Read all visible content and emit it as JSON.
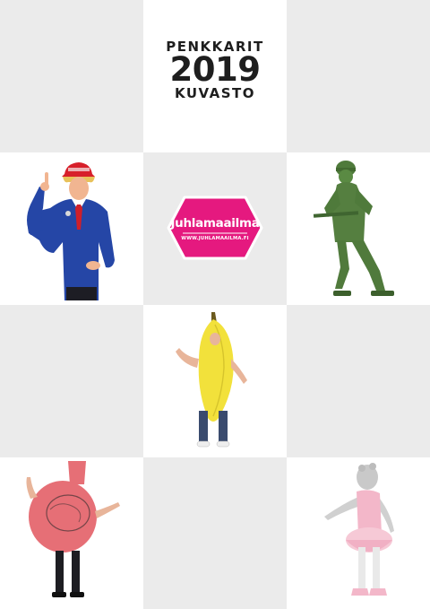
{
  "cover": {
    "title_top": "PENKKARIT",
    "title_year": "2019",
    "title_bottom": "KUVASTO"
  },
  "logo": {
    "brand": "Juhlamaailma",
    "url": "WWW.JUHLAMAAILMA.FI"
  },
  "colors": {
    "tile_gray": "#ebebeb",
    "brand_pink": "#e5197f",
    "title_text": "#1e1e1e"
  },
  "costumes": [
    {
      "name": "president-costume"
    },
    {
      "name": "toy-soldier-costume"
    },
    {
      "name": "banana-costume"
    },
    {
      "name": "whoopee-cushion-costume"
    },
    {
      "name": "ballerina-hippo-costume"
    }
  ]
}
